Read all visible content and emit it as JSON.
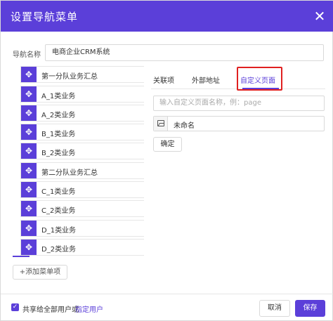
{
  "dialog": {
    "title": "设置导航菜单",
    "close_icon": "close-icon"
  },
  "nav_name": {
    "label": "导航名称",
    "value": "电商企业CRM系统"
  },
  "menu_items": [
    {
      "label": "第一分队业务汇总",
      "icon": "move-icon"
    },
    {
      "label": "A_1类业务",
      "icon": "move-icon"
    },
    {
      "label": "A_2类业务",
      "icon": "move-icon"
    },
    {
      "label": "B_1类业务",
      "icon": "move-icon"
    },
    {
      "label": "B_2类业务",
      "icon": "move-icon"
    },
    {
      "label": "第二分队业务汇总",
      "icon": "move-icon"
    },
    {
      "label": "C_1类业务",
      "icon": "move-icon"
    },
    {
      "label": "C_2类业务",
      "icon": "move-icon"
    },
    {
      "label": "D_1类业务",
      "icon": "move-icon"
    },
    {
      "label": "D_2类业务",
      "icon": "move-icon"
    }
  ],
  "add_item_label": "+添加菜单项",
  "tabs": [
    {
      "label": "关联项",
      "active": false
    },
    {
      "label": "外部地址",
      "active": false
    },
    {
      "label": "自定义页面",
      "active": true
    }
  ],
  "custom_page": {
    "placeholder": "输入自定义页面名称，例：page",
    "icon_value": "未命名",
    "confirm_label": "确定"
  },
  "footer": {
    "share_checked": true,
    "share_text": "共享给全部用户或",
    "share_link": "指定用户",
    "cancel_label": "取消",
    "save_label": "保存"
  },
  "colors": {
    "accent": "#5b3fd9",
    "highlight": "#e02020"
  }
}
